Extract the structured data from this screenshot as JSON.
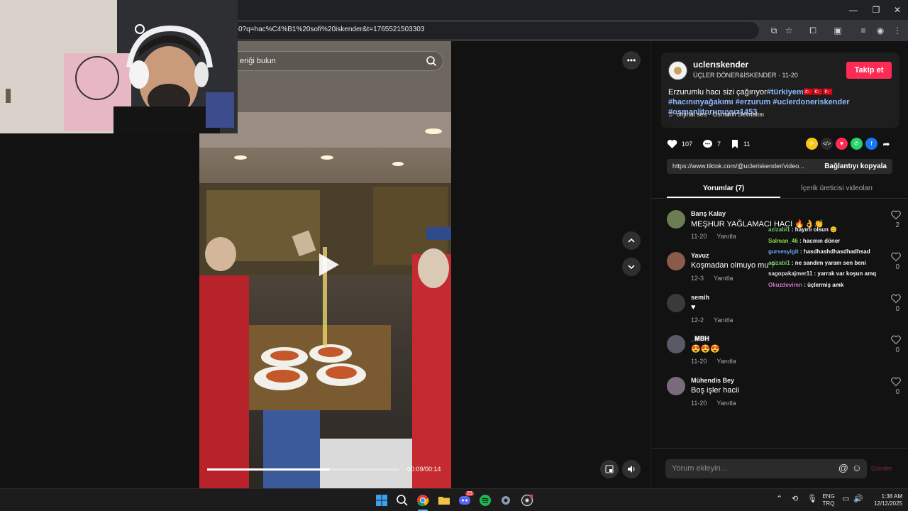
{
  "browser": {
    "url": "0?q=hac%C4%B1%20sofi%20iskender&t=1765521503303",
    "minimize": "—",
    "maximize": "❐",
    "close": "✕"
  },
  "video": {
    "search_placeholder": "eriği bulun",
    "time": "00:09/00:14",
    "progress_fraction": 0.64
  },
  "author": {
    "username": "uclerıskender",
    "display": "ÜÇLER DÖNER&İSKENDER · 11-20",
    "follow": "Takip et"
  },
  "caption": {
    "text": "Erzurumlu hacı sizi çağırıyor",
    "tag1": "#türkiyem🇹🇷🇹🇷🇹🇷",
    "tag2": "#hacınınyağakımı",
    "tag3": "#erzurum",
    "tag4": "#uclerdoneriskender",
    "tag5": "#osmanlitorunuyuz1453"
  },
  "music": "orijinal ses - Osmanlı Sevdalısı",
  "stats": {
    "likes": "107",
    "comments": "7",
    "saves": "11"
  },
  "link": {
    "url": "https://www.tiktok.com/@ucleriskender/video...",
    "copy": "Bağlantıyı kopyala"
  },
  "tabs": {
    "comments": "Yorumlar (7)",
    "creator_videos": "İçerik üreticisi videoları"
  },
  "comments": [
    {
      "user": "Barış Kalay",
      "text": "MEŞHUR YAĞLAMACI HACI 🔥👌👏",
      "date": "11-20",
      "reply": "Yanıtla",
      "likes": "2"
    },
    {
      "user": "Yavuz",
      "text": "Koşmadan olmuyo mu ?",
      "date": "12-3",
      "reply": "Yanıtla",
      "likes": "0"
    },
    {
      "user": "semih",
      "text": "♥",
      "date": "12-2",
      "reply": "Yanıtla",
      "likes": "0"
    },
    {
      "user": "_𝐌𝐁𝐇",
      "text": "😍😍😍",
      "date": "11-20",
      "reply": "Yanıtla",
      "likes": "0"
    },
    {
      "user": "Mühendis Bey",
      "text": "Boş işler hacii",
      "date": "11-20",
      "reply": "Yanıtla",
      "likes": "0"
    }
  ],
  "comment_input": {
    "placeholder": "Yorum ekleyin...",
    "send": "Gönder"
  },
  "chat": [
    {
      "user": "azizabi1",
      "color": "#7cd36b",
      "msg": ": hayırlı olsun 😊"
    },
    {
      "user": "Salman_46",
      "color": "#8be04e",
      "msg": ": hacının döner"
    },
    {
      "user": "gursesyigit",
      "color": "#6fa8ff",
      "msg": ": hasdhashdhasdhadhsad"
    },
    {
      "user": "azizabi1",
      "color": "#7cd36b",
      "msg": ": ne sandım yaram sen beni"
    },
    {
      "user": "sagopakajmer11",
      "color": "#e6e6e6",
      "msg": ": yarrak var koşun amq"
    },
    {
      "user": "Okuzdeviren",
      "color": "#d77bd0",
      "msg": ": üçlermiş amk"
    }
  ],
  "taskbar": {
    "lang_top": "ENG",
    "lang_bottom": "TRQ",
    "time": "1:38 AM",
    "date": "12/12/2025",
    "discord_badge": "25"
  },
  "colors": {
    "accent": "#fe2c55",
    "hashtag": "#8cb8ff",
    "panel_bg": "#121212"
  }
}
